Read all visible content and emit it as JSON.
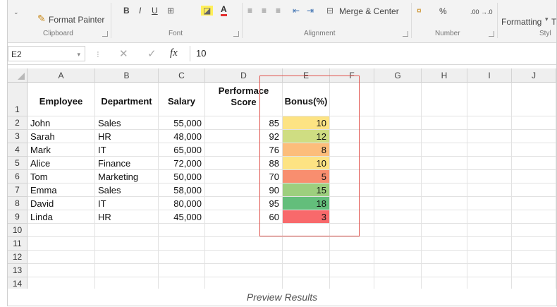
{
  "ribbon": {
    "format_painter": "Format Painter",
    "merge_center": "Merge & Center",
    "conditional_formatting": "Formatting",
    "styles_truncated": "T",
    "number_format": "%",
    "number_decimals": ".00 →.0",
    "groups": {
      "clipboard": "Clipboard",
      "font": "Font",
      "alignment": "Alignment",
      "number": "Number",
      "styles": "Styl"
    },
    "bold": "B",
    "italic": "I",
    "underline": "U"
  },
  "formula_bar": {
    "name_box": "E2",
    "fx": "fx",
    "value": "10"
  },
  "sheet": {
    "columns": [
      "A",
      "B",
      "C",
      "D",
      "E",
      "F",
      "G",
      "H",
      "I",
      "J"
    ],
    "row_numbers": [
      "1",
      "2",
      "3",
      "4",
      "5",
      "6",
      "7",
      "8",
      "9",
      "10",
      "11",
      "12",
      "13",
      "14"
    ],
    "headers": {
      "employee": "Employee",
      "department": "Department",
      "salary": "Salary",
      "performance_line1": "Performace",
      "performance_line2": "Score",
      "bonus": "Bonus(%)"
    },
    "rows": [
      {
        "employee": "John",
        "department": "Sales",
        "salary": "55,000",
        "score": "85",
        "bonus": "10",
        "color": "#fde383"
      },
      {
        "employee": "Sarah",
        "department": "HR",
        "salary": "48,000",
        "score": "92",
        "bonus": "12",
        "color": "#cfdd82"
      },
      {
        "employee": "Mark",
        "department": "IT",
        "salary": "65,000",
        "score": "76",
        "bonus": "8",
        "color": "#fcbd7b"
      },
      {
        "employee": "Alice",
        "department": "Finance",
        "salary": "72,000",
        "score": "88",
        "bonus": "10",
        "color": "#fde383"
      },
      {
        "employee": "Tom",
        "department": "Marketing",
        "salary": "50,000",
        "score": "70",
        "bonus": "5",
        "color": "#f88e6f"
      },
      {
        "employee": "Emma",
        "department": "Sales",
        "salary": "58,000",
        "score": "90",
        "bonus": "15",
        "color": "#9dcf7e"
      },
      {
        "employee": "David",
        "department": "IT",
        "salary": "80,000",
        "score": "95",
        "bonus": "18",
        "color": "#63be7b"
      },
      {
        "employee": "Linda",
        "department": "HR",
        "salary": "45,000",
        "score": "60",
        "bonus": "3",
        "color": "#f8696b"
      }
    ]
  },
  "caption": "Preview Results",
  "colors": {
    "highlight_border": "#e0504a"
  }
}
